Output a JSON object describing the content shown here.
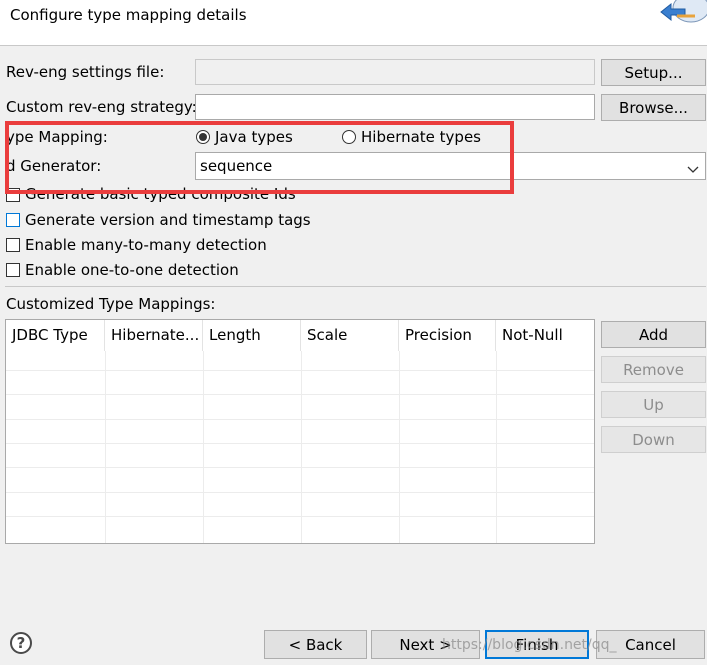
{
  "header": {
    "title": "Configure type mapping details"
  },
  "form": {
    "rev_eng_label": "Rev-eng settings file:",
    "rev_eng_value": "",
    "setup_label": "Setup...",
    "strategy_label": "Custom rev-eng strategy:",
    "strategy_value": "",
    "browse_label": "Browse...",
    "type_mapping_label": "ype Mapping:",
    "java_types_label": "Java types",
    "hibernate_types_label": "Hibernate types",
    "id_generator_label": "d Generator:",
    "id_generator_value": "sequence",
    "composite_ids_label": "Generate basic typed composite Ids",
    "version_tags_label": "Generate version and timestamp tags",
    "many_to_many_label": "Enable many-to-many detection",
    "one_to_one_label": "Enable one-to-one detection"
  },
  "mappings": {
    "label": "Customized Type Mappings:",
    "columns": [
      "JDBC Type",
      "Hibernate...",
      "Length",
      "Scale",
      "Precision",
      "Not-Null"
    ],
    "rows": [],
    "add_label": "Add",
    "remove_label": "Remove",
    "up_label": "Up",
    "down_label": "Down"
  },
  "footer": {
    "help_symbol": "?",
    "back_label": "< Back",
    "next_label": "Next >",
    "finish_label": "Finish",
    "cancel_label": "Cancel",
    "watermark": "https://blog.csdn.net/qq_"
  },
  "colors": {
    "highlight": "#ea3d3d",
    "focus": "#0078d7",
    "background": "#f0f0f0"
  },
  "icons": {
    "wizard": "wizard-banner-icon",
    "dropdown": "chevron-down-icon",
    "help": "help-icon"
  }
}
